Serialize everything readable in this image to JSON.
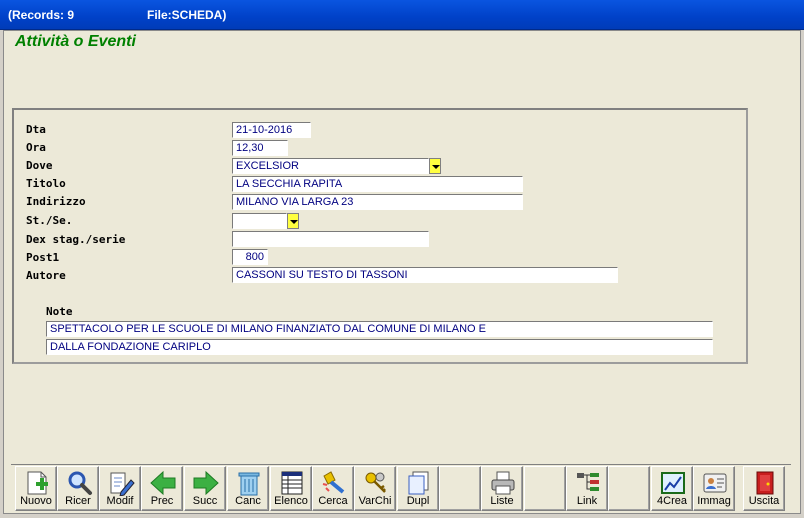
{
  "window": {
    "records_label": "(Records: 9",
    "file_label": "File:SCHEDA)"
  },
  "heading": "Attività o Eventi",
  "form": {
    "dta": {
      "label": "Dta",
      "value": "21-10-2016"
    },
    "ora": {
      "label": "Ora",
      "value": "12,30"
    },
    "dove": {
      "label": "Dove",
      "value": "EXCELSIOR"
    },
    "titolo": {
      "label": "Titolo",
      "value": "LA SECCHIA RAPITA"
    },
    "indirizzo": {
      "label": "Indirizzo",
      "value": "MILANO VIA LARGA 23"
    },
    "st_se": {
      "label": "St./Se.",
      "value": ""
    },
    "dex": {
      "label": "Dex stag./serie",
      "value": ""
    },
    "post1": {
      "label": "Post1",
      "value": "800"
    },
    "autore": {
      "label": "Autore",
      "value": "CASSONI SU TESTO DI TASSONI"
    },
    "note": {
      "label": "Note",
      "line1": "SPETTACOLO PER LE SCUOLE DI MILANO FINANZIATO DAL COMUNE DI MILANO E",
      "line2": "DALLA FONDAZIONE CARIPLO"
    }
  },
  "toolbar": {
    "nuovo": "Nuovo",
    "ricer": "Ricer",
    "modif": "Modif",
    "prec": "Prec",
    "succ": "Succ",
    "canc": "Canc",
    "elenco": "Elenco",
    "cerca": "Cerca",
    "varchi": "VarChi",
    "dupl": "Dupl",
    "liste": "Liste",
    "link": "Link",
    "crea": "4Crea",
    "immag": "Immag",
    "uscita": "Uscita"
  }
}
